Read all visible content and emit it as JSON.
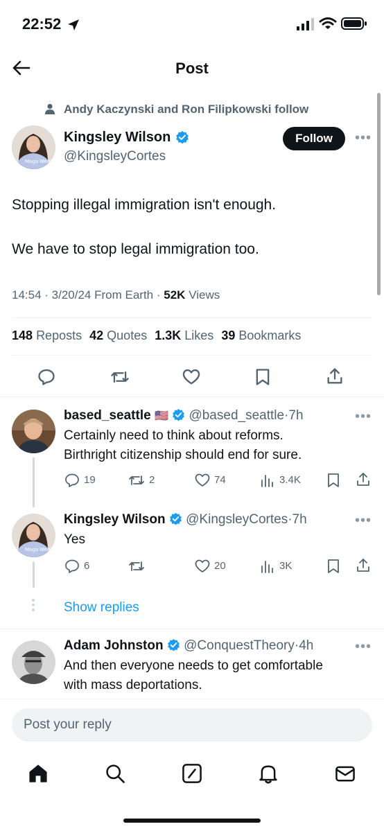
{
  "status_bar": {
    "time": "22:52"
  },
  "header": {
    "title": "Post"
  },
  "post": {
    "social_context": "Andy Kaczynski and Ron Filipkowski follow",
    "author_name": "Kingsley Wilson",
    "author_handle": "@KingsleyCortes",
    "follow_label": "Follow",
    "avatar_shirt_text": "Maga Wealthy",
    "text_line1": "Stopping illegal immigration isn't enough.",
    "text_line2": "We have to stop legal immigration too.",
    "time": "14:54",
    "date": "3/20/24",
    "source": "From Earth",
    "views_count": "52K",
    "views_label": "Views",
    "reposts_count": "148",
    "reposts_label": "Reposts",
    "quotes_count": "42",
    "quotes_label": "Quotes",
    "likes_count": "1.3K",
    "likes_label": "Likes",
    "bookmarks_count": "39",
    "bookmarks_label": "Bookmarks"
  },
  "replies": [
    {
      "name": "based_seattle",
      "flag": "🇺🇸",
      "handle": "@based_seattle",
      "age": "7h",
      "line1": "Certainly need to think about reforms.",
      "line2": "Birthright citizenship should end for sure.",
      "replies": "19",
      "reposts": "2",
      "likes": "74",
      "views": "3.4K"
    },
    {
      "name": "Kingsley Wilson",
      "handle": "@KingsleyCortes",
      "age": "7h",
      "line1": "Yes",
      "replies": "6",
      "reposts": "",
      "likes": "20",
      "views": "3K"
    },
    {
      "name": "Adam Johnston",
      "handle": "@ConquestTheory",
      "age": "4h",
      "line1": "And then everyone needs to get comfortable",
      "line2": "with mass deportations."
    }
  ],
  "show_replies_label": "Show replies",
  "composer": {
    "placeholder": "Post your reply"
  },
  "colors": {
    "accent": "#1d9bf0",
    "text": "#0f1419",
    "muted": "#536471",
    "follow_bg": "#0f1419"
  }
}
